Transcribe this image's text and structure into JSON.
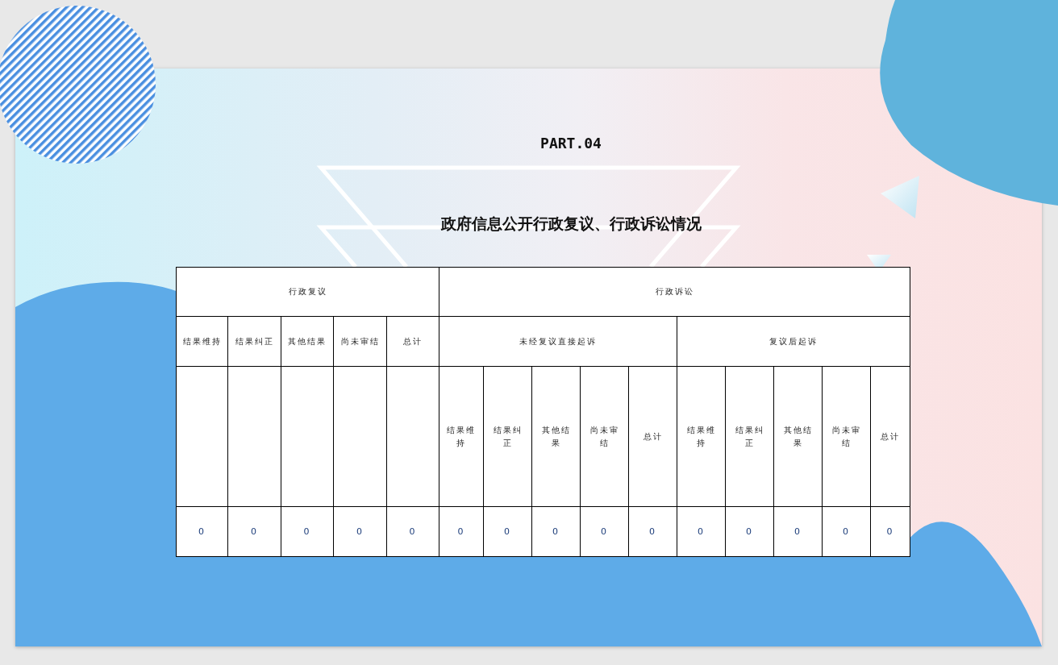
{
  "part": "PART.04",
  "title": "政府信息公开行政复议、行政诉讼情况",
  "table": {
    "groups": [
      {
        "label": "行政复议",
        "columns": [
          "结果维持",
          "结果纠正",
          "其他结果",
          "尚未审结",
          "总计"
        ]
      },
      {
        "label": "行政诉讼",
        "subgroups": [
          {
            "label": "未经复议直接起诉",
            "columns": [
              "结果维持",
              "结果纠正",
              "其他结果",
              "尚未审结",
              "总计"
            ]
          },
          {
            "label": "复议后起诉",
            "columns": [
              "结果维持",
              "结果纠正",
              "其他结果",
              "尚未审结",
              "总计"
            ]
          }
        ]
      }
    ],
    "rows": [
      [
        "0",
        "0",
        "0",
        "0",
        "0",
        "0",
        "0",
        "0",
        "0",
        "0",
        "0",
        "0",
        "0",
        "0",
        "0"
      ]
    ]
  }
}
